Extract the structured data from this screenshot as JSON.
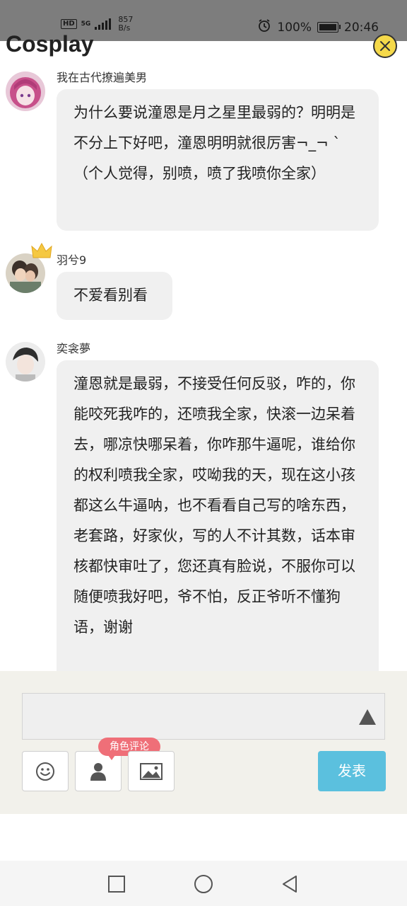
{
  "status_bar": {
    "hd": "HD",
    "network": "5G",
    "speed_value": "857",
    "speed_unit": "B/s",
    "battery": "100%",
    "time": "20:46"
  },
  "header": {
    "title": "Cosplay"
  },
  "comments": [
    {
      "username": "我在古代撩遍美男",
      "text": "为什么要说潼恩是月之星里最弱的？明明是不分上下好吧，潼恩明明就很厉害¬_¬ `（个人觉得，别喷，喷了我喷你全家）",
      "avatar": "anime-girl-avatar"
    },
    {
      "username": "羽兮9",
      "text": "不爱看别看",
      "avatar": "couple-avatar",
      "badge": "crown-icon"
    },
    {
      "username": "奕衾夢",
      "text": "潼恩就是最弱，不接受任何反驳，咋的，你能咬死我咋的，还喷我全家，快滚一边呆着去，哪凉快哪呆着，你咋那牛逼呢，谁给你的权利喷我全家，哎呦我的天，现在这小孩都这么牛逼呐，也不看看自己写的啥东西，老套路，好家伙，写的人不计其数，话本审核都快审吐了，您还真有脸说，不服你可以随便喷我好吧，爷不怕，反正爷听不懂狗语，谢谢",
      "avatar": "boy-avatar"
    }
  ],
  "input_panel": {
    "text_value": "",
    "role_tag": "角色评论",
    "publish_label": "发表"
  },
  "colors": {
    "publish": "#5bc0de",
    "role_tag": "#ef6f78",
    "close_button": "#f5d94a",
    "bubble": "#f0f0f0"
  }
}
